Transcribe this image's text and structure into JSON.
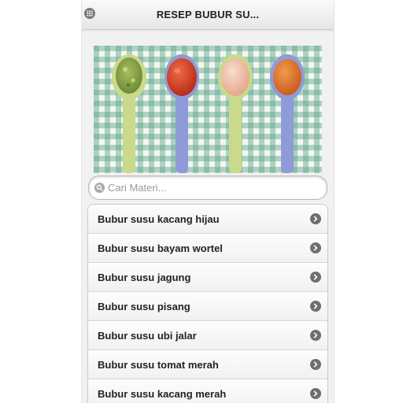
{
  "header": {
    "title": "RESEP BUBUR SU...",
    "menu_icon": "grid-menu-icon"
  },
  "banner": {
    "image": "four-spoons-with-baby-porridge-on-gingham-cloth",
    "colors": {
      "cloth_check": "#5aa58a",
      "spoon_green": "#c9da8a",
      "spoon_blue": "#8f9bd8",
      "porridge_green": "#8aa24a",
      "porridge_red": "#d8452a",
      "porridge_peach": "#f2c2ac",
      "porridge_orange": "#e0782e"
    }
  },
  "search": {
    "placeholder": "Cari Materi...",
    "value": "",
    "icon": "search-icon"
  },
  "list": {
    "items": [
      {
        "label": "Bubur susu kacang hijau"
      },
      {
        "label": "Bubur susu bayam wortel"
      },
      {
        "label": "Bubur susu jagung"
      },
      {
        "label": "Bubur susu pisang"
      },
      {
        "label": "Bubur susu ubi jalar"
      },
      {
        "label": "Bubur susu tomat merah"
      },
      {
        "label": "Bubur susu kacang merah"
      }
    ],
    "item_icon": "chevron-right-icon"
  },
  "colors": {
    "header_bg": "#ececec",
    "page_bg": "#f1f1f1",
    "chevron": "#6f6f6f"
  }
}
